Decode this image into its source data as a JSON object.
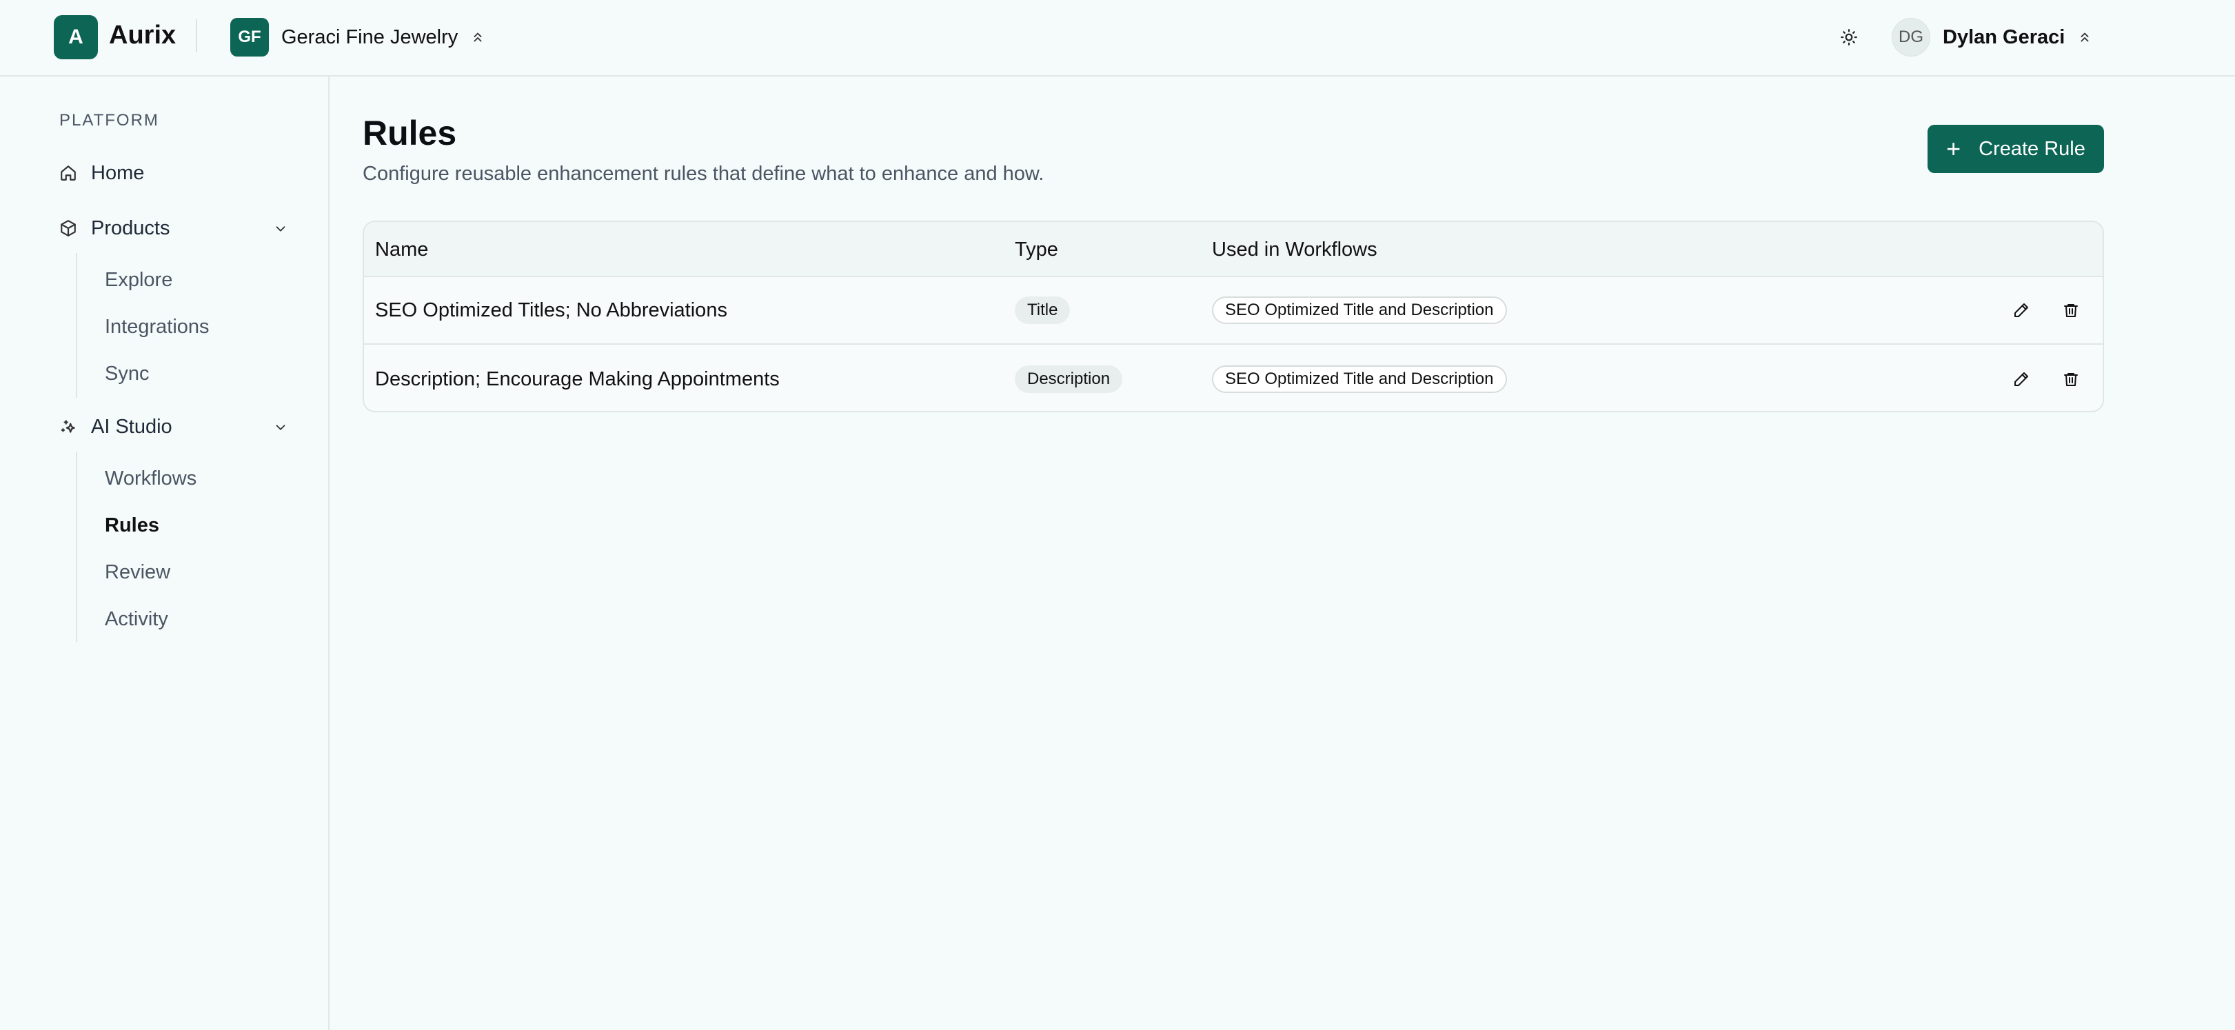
{
  "app": {
    "logo_letter": "A",
    "name": "Aurix"
  },
  "org": {
    "initials": "GF",
    "name": "Geraci Fine Jewelry"
  },
  "user": {
    "initials": "DG",
    "name": "Dylan Geraci"
  },
  "sidebar": {
    "section_label": "PLATFORM",
    "home": "Home",
    "products": {
      "label": "Products",
      "items": [
        "Explore",
        "Integrations",
        "Sync"
      ]
    },
    "ai_studio": {
      "label": "AI Studio",
      "items": [
        "Workflows",
        "Rules",
        "Review",
        "Activity"
      ],
      "active": "Rules"
    }
  },
  "page": {
    "title": "Rules",
    "subtitle": "Configure reusable enhancement rules that define what to enhance and how.",
    "create_button": "Create Rule"
  },
  "table": {
    "headers": [
      "Name",
      "Type",
      "Used in Workflows"
    ],
    "rows": [
      {
        "name": "SEO Optimized Titles; No Abbreviations",
        "type": "Title",
        "workflow": "SEO Optimized Title and Description"
      },
      {
        "name": "Description; Encourage Making Appointments",
        "type": "Description",
        "workflow": "SEO Optimized Title and Description"
      }
    ]
  },
  "colors": {
    "brand": "#0d6655",
    "background": "#f5fafa",
    "border": "#e0e6e6"
  },
  "icons": [
    "sun-icon",
    "chevrons-up-icon",
    "home-icon",
    "box-icon",
    "sparkles-icon",
    "chevron-down-icon",
    "plus-icon",
    "pencil-icon",
    "trash-icon"
  ]
}
